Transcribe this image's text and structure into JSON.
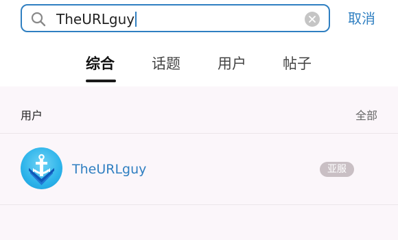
{
  "search": {
    "query": "TheURLguy",
    "cancel_label": "取消"
  },
  "tabs": [
    {
      "label": "综合",
      "active": true
    },
    {
      "label": "话题",
      "active": false
    },
    {
      "label": "用户",
      "active": false
    },
    {
      "label": "帖子",
      "active": false
    }
  ],
  "users_section": {
    "title": "用户",
    "more_label": "全部",
    "items": [
      {
        "name": "TheURLguy",
        "server_badge": "亚服",
        "avatar_icon": "anchor-shield-icon"
      }
    ]
  },
  "colors": {
    "accent": "#2f7fc1",
    "background": "#fbf6fa",
    "badge": "#c9bfc4"
  }
}
